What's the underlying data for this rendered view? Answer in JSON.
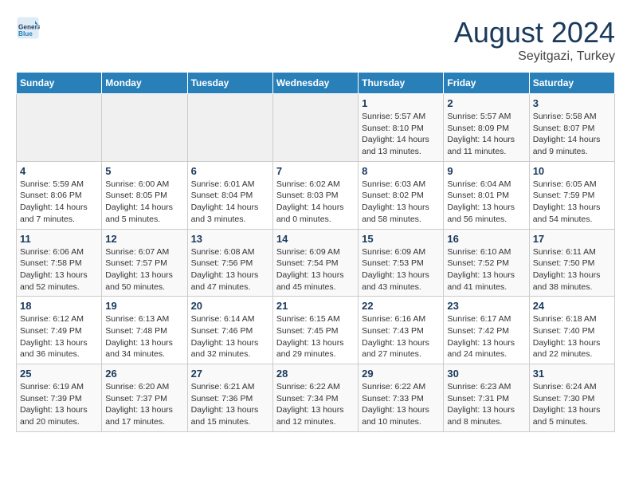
{
  "header": {
    "logo_line1": "General",
    "logo_line2": "Blue",
    "month": "August 2024",
    "location": "Seyitgazi, Turkey"
  },
  "days_of_week": [
    "Sunday",
    "Monday",
    "Tuesday",
    "Wednesday",
    "Thursday",
    "Friday",
    "Saturday"
  ],
  "weeks": [
    [
      {
        "day": "",
        "info": ""
      },
      {
        "day": "",
        "info": ""
      },
      {
        "day": "",
        "info": ""
      },
      {
        "day": "",
        "info": ""
      },
      {
        "day": "1",
        "info": "Sunrise: 5:57 AM\nSunset: 8:10 PM\nDaylight: 14 hours and 13 minutes."
      },
      {
        "day": "2",
        "info": "Sunrise: 5:57 AM\nSunset: 8:09 PM\nDaylight: 14 hours and 11 minutes."
      },
      {
        "day": "3",
        "info": "Sunrise: 5:58 AM\nSunset: 8:07 PM\nDaylight: 14 hours and 9 minutes."
      }
    ],
    [
      {
        "day": "4",
        "info": "Sunrise: 5:59 AM\nSunset: 8:06 PM\nDaylight: 14 hours and 7 minutes."
      },
      {
        "day": "5",
        "info": "Sunrise: 6:00 AM\nSunset: 8:05 PM\nDaylight: 14 hours and 5 minutes."
      },
      {
        "day": "6",
        "info": "Sunrise: 6:01 AM\nSunset: 8:04 PM\nDaylight: 14 hours and 3 minutes."
      },
      {
        "day": "7",
        "info": "Sunrise: 6:02 AM\nSunset: 8:03 PM\nDaylight: 14 hours and 0 minutes."
      },
      {
        "day": "8",
        "info": "Sunrise: 6:03 AM\nSunset: 8:02 PM\nDaylight: 13 hours and 58 minutes."
      },
      {
        "day": "9",
        "info": "Sunrise: 6:04 AM\nSunset: 8:01 PM\nDaylight: 13 hours and 56 minutes."
      },
      {
        "day": "10",
        "info": "Sunrise: 6:05 AM\nSunset: 7:59 PM\nDaylight: 13 hours and 54 minutes."
      }
    ],
    [
      {
        "day": "11",
        "info": "Sunrise: 6:06 AM\nSunset: 7:58 PM\nDaylight: 13 hours and 52 minutes."
      },
      {
        "day": "12",
        "info": "Sunrise: 6:07 AM\nSunset: 7:57 PM\nDaylight: 13 hours and 50 minutes."
      },
      {
        "day": "13",
        "info": "Sunrise: 6:08 AM\nSunset: 7:56 PM\nDaylight: 13 hours and 47 minutes."
      },
      {
        "day": "14",
        "info": "Sunrise: 6:09 AM\nSunset: 7:54 PM\nDaylight: 13 hours and 45 minutes."
      },
      {
        "day": "15",
        "info": "Sunrise: 6:09 AM\nSunset: 7:53 PM\nDaylight: 13 hours and 43 minutes."
      },
      {
        "day": "16",
        "info": "Sunrise: 6:10 AM\nSunset: 7:52 PM\nDaylight: 13 hours and 41 minutes."
      },
      {
        "day": "17",
        "info": "Sunrise: 6:11 AM\nSunset: 7:50 PM\nDaylight: 13 hours and 38 minutes."
      }
    ],
    [
      {
        "day": "18",
        "info": "Sunrise: 6:12 AM\nSunset: 7:49 PM\nDaylight: 13 hours and 36 minutes."
      },
      {
        "day": "19",
        "info": "Sunrise: 6:13 AM\nSunset: 7:48 PM\nDaylight: 13 hours and 34 minutes."
      },
      {
        "day": "20",
        "info": "Sunrise: 6:14 AM\nSunset: 7:46 PM\nDaylight: 13 hours and 32 minutes."
      },
      {
        "day": "21",
        "info": "Sunrise: 6:15 AM\nSunset: 7:45 PM\nDaylight: 13 hours and 29 minutes."
      },
      {
        "day": "22",
        "info": "Sunrise: 6:16 AM\nSunset: 7:43 PM\nDaylight: 13 hours and 27 minutes."
      },
      {
        "day": "23",
        "info": "Sunrise: 6:17 AM\nSunset: 7:42 PM\nDaylight: 13 hours and 24 minutes."
      },
      {
        "day": "24",
        "info": "Sunrise: 6:18 AM\nSunset: 7:40 PM\nDaylight: 13 hours and 22 minutes."
      }
    ],
    [
      {
        "day": "25",
        "info": "Sunrise: 6:19 AM\nSunset: 7:39 PM\nDaylight: 13 hours and 20 minutes."
      },
      {
        "day": "26",
        "info": "Sunrise: 6:20 AM\nSunset: 7:37 PM\nDaylight: 13 hours and 17 minutes."
      },
      {
        "day": "27",
        "info": "Sunrise: 6:21 AM\nSunset: 7:36 PM\nDaylight: 13 hours and 15 minutes."
      },
      {
        "day": "28",
        "info": "Sunrise: 6:22 AM\nSunset: 7:34 PM\nDaylight: 13 hours and 12 minutes."
      },
      {
        "day": "29",
        "info": "Sunrise: 6:22 AM\nSunset: 7:33 PM\nDaylight: 13 hours and 10 minutes."
      },
      {
        "day": "30",
        "info": "Sunrise: 6:23 AM\nSunset: 7:31 PM\nDaylight: 13 hours and 8 minutes."
      },
      {
        "day": "31",
        "info": "Sunrise: 6:24 AM\nSunset: 7:30 PM\nDaylight: 13 hours and 5 minutes."
      }
    ]
  ]
}
